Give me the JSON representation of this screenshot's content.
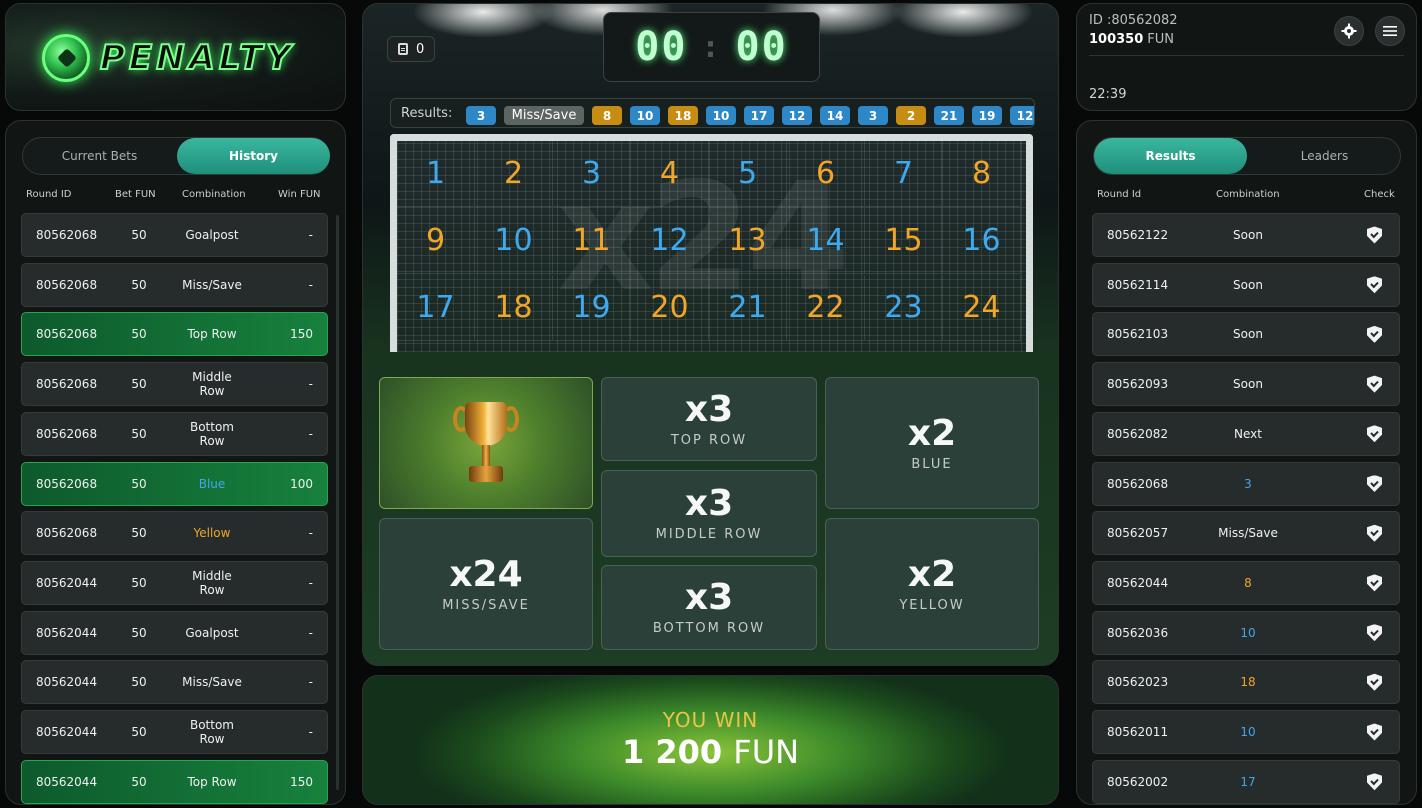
{
  "logo": {
    "text": "PENALTY"
  },
  "history": {
    "tabs": [
      {
        "label": "Current Bets",
        "active": false
      },
      {
        "label": "History",
        "active": true
      }
    ],
    "columns": {
      "round": "Round ID",
      "bet": "Bet FUN",
      "combination": "Combination",
      "win": "Win FUN"
    },
    "rows": [
      {
        "round": "80562068",
        "bet": "50",
        "combination": "Goalpost",
        "win": "-",
        "won": false,
        "comb_color": ""
      },
      {
        "round": "80562068",
        "bet": "50",
        "combination": "Miss/Save",
        "win": "-",
        "won": false,
        "comb_color": ""
      },
      {
        "round": "80562068",
        "bet": "50",
        "combination": "Top Row",
        "win": "150",
        "won": true,
        "comb_color": ""
      },
      {
        "round": "80562068",
        "bet": "50",
        "combination": "Middle Row",
        "win": "-",
        "won": false,
        "comb_color": ""
      },
      {
        "round": "80562068",
        "bet": "50",
        "combination": "Bottom Row",
        "win": "-",
        "won": false,
        "comb_color": ""
      },
      {
        "round": "80562068",
        "bet": "50",
        "combination": "Blue",
        "win": "100",
        "won": true,
        "comb_color": "blue"
      },
      {
        "round": "80562068",
        "bet": "50",
        "combination": "Yellow",
        "win": "-",
        "won": false,
        "comb_color": "yellow"
      },
      {
        "round": "80562044",
        "bet": "50",
        "combination": "Middle Row",
        "win": "-",
        "won": false,
        "comb_color": ""
      },
      {
        "round": "80562044",
        "bet": "50",
        "combination": "Goalpost",
        "win": "-",
        "won": false,
        "comb_color": ""
      },
      {
        "round": "80562044",
        "bet": "50",
        "combination": "Miss/Save",
        "win": "-",
        "won": false,
        "comb_color": ""
      },
      {
        "round": "80562044",
        "bet": "50",
        "combination": "Bottom Row",
        "win": "-",
        "won": false,
        "comb_color": ""
      },
      {
        "round": "80562044",
        "bet": "50",
        "combination": "Top Row",
        "win": "150",
        "won": true,
        "comb_color": ""
      }
    ]
  },
  "stage": {
    "counter": "0",
    "timer": {
      "minutes": "00",
      "seconds": "00"
    },
    "results_label": "Results:",
    "recent_results": [
      {
        "value": "3",
        "color": "blue"
      },
      {
        "value": "Miss/Save",
        "color": "gray"
      },
      {
        "value": "8",
        "color": "yellow"
      },
      {
        "value": "10",
        "color": "blue"
      },
      {
        "value": "18",
        "color": "yellow"
      },
      {
        "value": "10",
        "color": "blue"
      },
      {
        "value": "17",
        "color": "blue"
      },
      {
        "value": "12",
        "color": "blue"
      },
      {
        "value": "14",
        "color": "blue"
      },
      {
        "value": "3",
        "color": "blue"
      },
      {
        "value": "2",
        "color": "yellow"
      },
      {
        "value": "21",
        "color": "blue"
      },
      {
        "value": "19",
        "color": "blue"
      },
      {
        "value": "12",
        "color": "blue"
      }
    ],
    "goal_watermark": "x24",
    "goal_cells": [
      {
        "n": "1",
        "color": "blue"
      },
      {
        "n": "2",
        "color": "yellow"
      },
      {
        "n": "3",
        "color": "blue"
      },
      {
        "n": "4",
        "color": "yellow"
      },
      {
        "n": "5",
        "color": "blue"
      },
      {
        "n": "6",
        "color": "yellow"
      },
      {
        "n": "7",
        "color": "blue"
      },
      {
        "n": "8",
        "color": "yellow"
      },
      {
        "n": "9",
        "color": "yellow"
      },
      {
        "n": "10",
        "color": "blue"
      },
      {
        "n": "11",
        "color": "yellow"
      },
      {
        "n": "12",
        "color": "blue"
      },
      {
        "n": "13",
        "color": "yellow"
      },
      {
        "n": "14",
        "color": "blue"
      },
      {
        "n": "15",
        "color": "yellow"
      },
      {
        "n": "16",
        "color": "blue"
      },
      {
        "n": "17",
        "color": "blue"
      },
      {
        "n": "18",
        "color": "yellow"
      },
      {
        "n": "19",
        "color": "blue"
      },
      {
        "n": "20",
        "color": "yellow"
      },
      {
        "n": "21",
        "color": "blue"
      },
      {
        "n": "22",
        "color": "yellow"
      },
      {
        "n": "23",
        "color": "blue"
      },
      {
        "n": "24",
        "color": "yellow"
      }
    ],
    "bets": {
      "top_row": {
        "mult": "x3",
        "label": "TOP ROW"
      },
      "middle_row": {
        "mult": "x3",
        "label": "MIDDLE ROW"
      },
      "bottom_row": {
        "mult": "x3",
        "label": "BOTTOM ROW"
      },
      "miss_save": {
        "mult": "x24",
        "label": "MISS/SAVE"
      },
      "blue": {
        "mult": "x2",
        "label": "BLUE"
      },
      "yellow": {
        "mult": "x2",
        "label": "YELLOW"
      }
    }
  },
  "win": {
    "title": "YOU WIN",
    "amount": "1 200",
    "currency": "FUN"
  },
  "account": {
    "id": "ID :80562082",
    "balance": "100350",
    "currency": "FUN",
    "time": "22:39"
  },
  "results": {
    "tabs": [
      {
        "label": "Results",
        "active": true
      },
      {
        "label": "Leaders",
        "active": false
      }
    ],
    "columns": {
      "round": "Round Id",
      "combination": "Combination",
      "check": "Check"
    },
    "rows": [
      {
        "round": "80562122",
        "combination": "Soon",
        "color": ""
      },
      {
        "round": "80562114",
        "combination": "Soon",
        "color": ""
      },
      {
        "round": "80562103",
        "combination": "Soon",
        "color": ""
      },
      {
        "round": "80562093",
        "combination": "Soon",
        "color": ""
      },
      {
        "round": "80562082",
        "combination": "Next",
        "color": ""
      },
      {
        "round": "80562068",
        "combination": "3",
        "color": "blue"
      },
      {
        "round": "80562057",
        "combination": "Miss/Save",
        "color": ""
      },
      {
        "round": "80562044",
        "combination": "8",
        "color": "yellow"
      },
      {
        "round": "80562036",
        "combination": "10",
        "color": "blue"
      },
      {
        "round": "80562023",
        "combination": "18",
        "color": "yellow"
      },
      {
        "round": "80562011",
        "combination": "10",
        "color": "blue"
      },
      {
        "round": "80562002",
        "combination": "17",
        "color": "blue"
      }
    ]
  },
  "colors": {
    "accent": "#2fa98f",
    "blue": "#41a7ec",
    "yellow": "#f0a52a",
    "win_row": "#17813d"
  },
  "icons": {
    "settings": "gear-icon",
    "menu": "hamburger-menu-icon",
    "check": "shield-check-icon",
    "counter": "clipboard-icon"
  }
}
